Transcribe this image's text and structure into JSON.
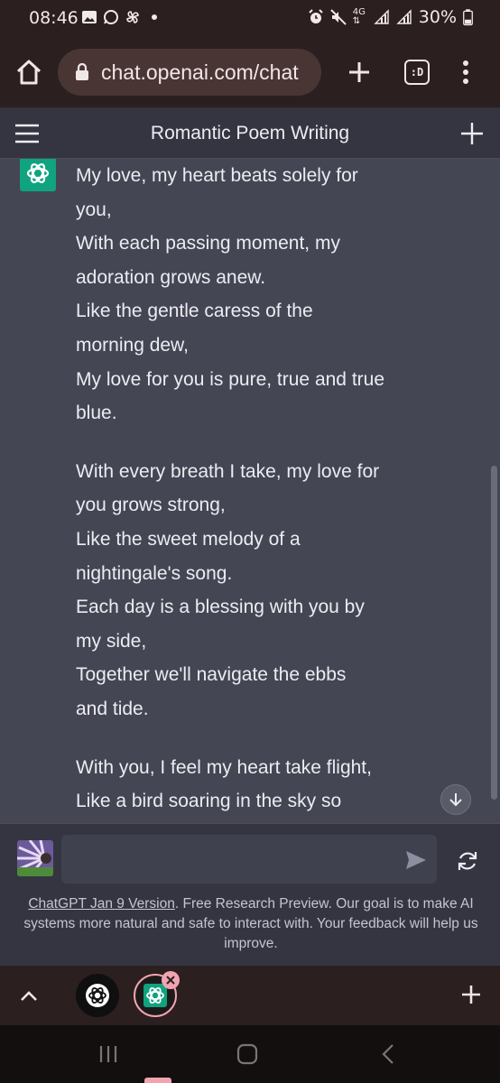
{
  "status_bar": {
    "time": "08:46",
    "left_icons": [
      "gallery-icon",
      "whatsapp-icon",
      "pinwheel-icon",
      "dot-icon"
    ],
    "right_icons": [
      "alarm-icon",
      "mute-icon",
      "network-4g-icon",
      "signal-icon",
      "signal-icon"
    ],
    "network_label": "4G",
    "battery": "30%"
  },
  "browser": {
    "url": "chat.openai.com/chat",
    "tabs_label": ":D"
  },
  "chat": {
    "title": "Romantic Poem Writing",
    "poem": [
      [
        "My love, my heart beats solely for",
        "you,",
        "With each passing moment, my",
        "adoration grows anew.",
        "Like the gentle caress of the",
        "morning dew,",
        "My love for you is pure, true and true",
        "blue."
      ],
      [
        "With every breath I take, my love for",
        "you grows strong,",
        "Like the sweet melody of a",
        "nightingale's song.",
        "Each day is a blessing with you by",
        "my side,",
        "Together we'll navigate the ebbs",
        "and tide."
      ],
      [
        "With you, I feel my heart take flight,",
        "Like a bird soaring in the sky so"
      ]
    ]
  },
  "input": {
    "placeholder": "",
    "footer_link": "ChatGPT Jan 9 Version",
    "footer_text": ". Free Research Preview. Our goal is to make AI systems more natural and safe to interact with. Your feedback will help us improve."
  },
  "colors": {
    "accent": "#10a37f",
    "chat_bg": "#444654",
    "header_bg": "#343541",
    "browser_bg": "#2b1f1f",
    "tab_highlight": "#f1a4b0"
  }
}
